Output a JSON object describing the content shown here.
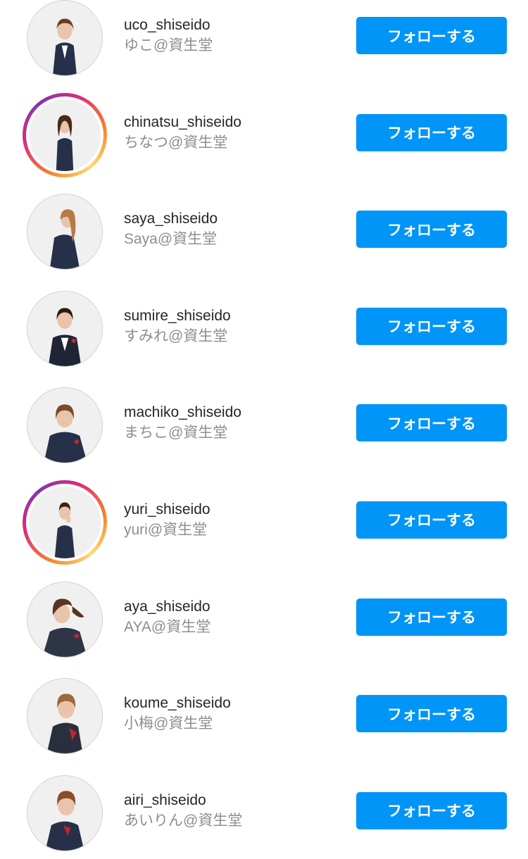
{
  "colors": {
    "follow_button": "#0095f6",
    "follow_text": "#ffffff",
    "username_text": "#262626",
    "fullname_text": "#8e8e8e",
    "story_ring": [
      "#f58529",
      "#dd2a7b",
      "#8134af"
    ]
  },
  "accounts": [
    {
      "username": "uco_shiseido",
      "fullname": "ゆこ@資生堂",
      "story_ring": false,
      "follow_label": "フォローする"
    },
    {
      "username": "chinatsu_shiseido",
      "fullname": "ちなつ@資生堂",
      "story_ring": true,
      "follow_label": "フォローする"
    },
    {
      "username": "saya_shiseido",
      "fullname": "Saya@資生堂",
      "story_ring": false,
      "follow_label": "フォローする"
    },
    {
      "username": "sumire_shiseido",
      "fullname": "すみれ@資生堂",
      "story_ring": false,
      "follow_label": "フォローする"
    },
    {
      "username": "machiko_shiseido",
      "fullname": "まちこ@資生堂",
      "story_ring": false,
      "follow_label": "フォローする"
    },
    {
      "username": "yuri_shiseido",
      "fullname": "yuri@資生堂",
      "story_ring": true,
      "follow_label": "フォローする"
    },
    {
      "username": "aya_shiseido",
      "fullname": "AYA@資生堂",
      "story_ring": false,
      "follow_label": "フォローする"
    },
    {
      "username": "koume_shiseido",
      "fullname": "小梅@資生堂",
      "story_ring": false,
      "follow_label": "フォローする"
    },
    {
      "username": "airi_shiseido",
      "fullname": "あいりん@資生堂",
      "story_ring": false,
      "follow_label": "フォローする"
    }
  ]
}
